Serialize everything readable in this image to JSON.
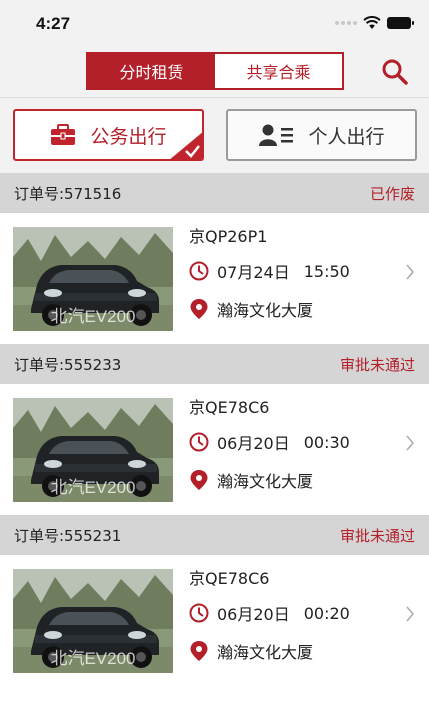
{
  "status_bar": {
    "time": "4:27"
  },
  "nav": {
    "tabs": [
      {
        "label": "分时租赁",
        "active": true
      },
      {
        "label": "共享合乘",
        "active": false
      }
    ],
    "search_icon": "search-icon"
  },
  "modes": {
    "business": {
      "label": "公务出行",
      "icon": "briefcase-icon",
      "selected": true
    },
    "personal": {
      "label": "个人出行",
      "icon": "person-list-icon",
      "selected": false
    }
  },
  "orders": [
    {
      "order_no": "订单号:571516",
      "status": "已作废",
      "car_name": "北汽EV200",
      "plate": "京QP26P1",
      "date": "07月24日",
      "time": "15:50",
      "location": "瀚海文化大厦"
    },
    {
      "order_no": "订单号:555233",
      "status": "审批未通过",
      "car_name": "北汽EV200",
      "plate": "京QE78C6",
      "date": "06月20日",
      "time": "00:30",
      "location": "瀚海文化大厦"
    },
    {
      "order_no": "订单号:555231",
      "status": "审批未通过",
      "car_name": "北汽EV200",
      "plate": "京QE78C6",
      "date": "06月20日",
      "time": "00:20",
      "location": "瀚海文化大厦"
    }
  ],
  "colors": {
    "accent": "#b3202a",
    "header_bg": "#d5d5d5",
    "bar_bg": "#f2f2f2"
  }
}
